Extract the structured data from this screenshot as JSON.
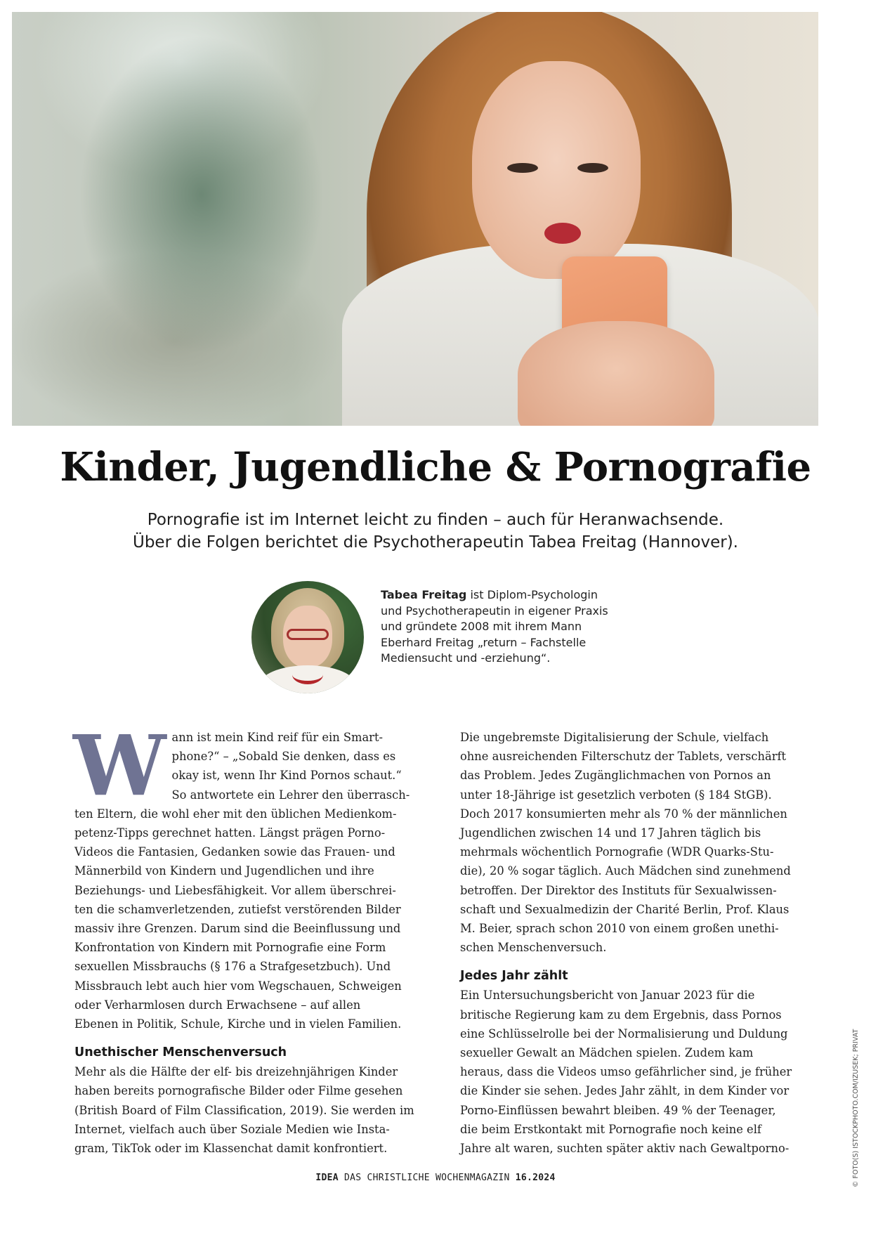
{
  "headline": "Kinder, Jugendliche & Pornografie",
  "lede": {
    "line1": "Pornografie ist im Internet leicht zu finden – auch für Heranwachsende.",
    "line2": "Über die Folgen berichtet die Psychotherapeutin Tabea Freitag (Hannover)."
  },
  "bio": {
    "name": "Tabea Freitag",
    "lines": [
      " ist Diplom-Psychologin",
      "und Psychotherapeutin in eigener Praxis",
      "und gründete 2008 mit ihrem Mann",
      "Eberhard Freitag „return – Fachstelle",
      "Mediensucht und -erziehung“."
    ]
  },
  "left_column": {
    "dropcap": "W",
    "intro_lines": [
      "ann ist mein Kind reif für ein Smart-",
      "phone?“ – „Sobald Sie denken, dass es",
      "okay ist, wenn Ihr Kind Pornos schaut.“",
      "So antwortete ein Lehrer den überrasch-"
    ],
    "body_lines": [
      "ten Eltern, die wohl eher mit den üblichen Medienkom-",
      "petenz-Tipps gerechnet hatten. Längst prägen Porno-",
      "Videos die Fantasien, Gedanken sowie das Frauen- und",
      "Männerbild von Kindern und Jugendlichen und ihre",
      "Beziehungs- und Liebesfähigkeit. Vor allem überschrei-",
      "ten die schamverletzenden, zutiefst verstörenden Bilder",
      "massiv ihre Grenzen. Darum sind die Beeinflussung und",
      "Konfrontation von Kindern mit Pornografie eine Form",
      "sexuellen Missbrauchs (§ 176 a Strafgesetzbuch). Und",
      "Missbrauch lebt auch hier vom Wegschauen, Schweigen",
      "oder Verharmlosen durch Erwachsene – auf allen",
      "Ebenen in Politik, Schule, Kirche und in vielen Familien."
    ],
    "subheading": "Unethischer Menschenversuch",
    "section2_lines": [
      "Mehr als die Hälfte der elf- bis dreizehnjährigen Kinder",
      "haben bereits pornografische Bilder oder Filme gesehen",
      "(British Board of Film Classification, 2019). Sie werden im",
      "Internet, vielfach auch über Soziale Medien wie Insta-",
      "gram, TikTok oder im Klassenchat damit konfrontiert."
    ]
  },
  "right_column": {
    "paragraph1_lines": [
      "Die ungebremste Digitalisierung der Schule, vielfach",
      "ohne ausreichenden Filterschutz der Tablets, verschärft",
      "das Problem. Jedes Zugänglichmachen von Pornos an",
      "unter 18-Jährige ist gesetzlich verboten (§ 184 StGB).",
      "Doch 2017 konsumierten mehr als 70 % der männlichen",
      "Jugendlichen zwischen 14 und 17 Jahren täglich bis",
      "mehrmals wöchentlich Pornografie (WDR Quarks-Stu-",
      "die), 20 % sogar täglich. Auch Mädchen sind zunehmend",
      "betroffen. Der Direktor des Instituts für Sexualwissen-",
      "schaft und Sexualmedizin der Charité Berlin, Prof. Klaus",
      "M. Beier, sprach schon 2010 von einem großen unethi-",
      "schen Menschenversuch."
    ],
    "subheading": "Jedes Jahr zählt",
    "paragraph2_lines": [
      "Ein Untersuchungsbericht von Januar 2023 für die",
      "britische Regierung kam zu dem Ergebnis, dass Pornos",
      "eine Schlüsselrolle bei der Normalisierung und Duldung",
      "sexueller Gewalt an Mädchen spielen. Zudem kam",
      "heraus, dass die Videos umso gefährlicher sind, je früher",
      "die Kinder sie sehen. Jedes Jahr zählt, in dem Kinder vor",
      "Porno-Einflüssen bewahrt bleiben. 49 % der Teenager,",
      "die beim Erstkontakt mit Pornografie noch keine elf",
      "Jahre alt waren, suchten später aktiv nach Gewaltporno-"
    ]
  },
  "footer": {
    "brand": "IDEA",
    "magazine": " DAS CHRISTLICHE WOCHENMAGAZIN ",
    "issue": "16.2024"
  },
  "credit": "© FOTO(S) ISTOCKPHOTO.COM/IZUSEK; PRIVAT"
}
